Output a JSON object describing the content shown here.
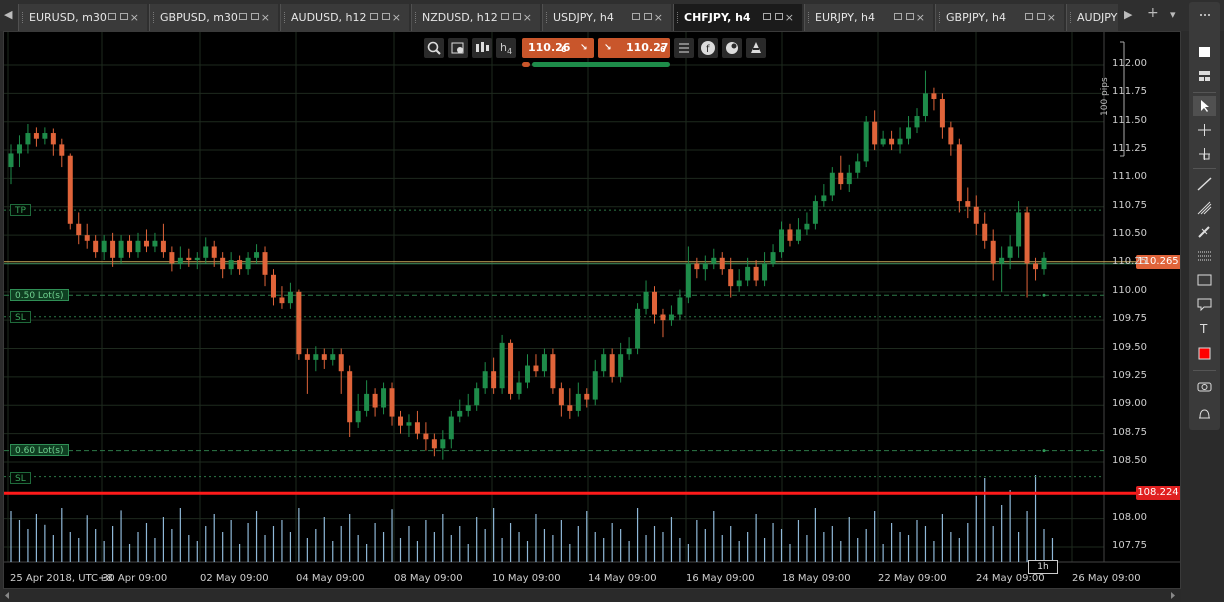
{
  "tabs": [
    {
      "label": "EURUSD, m30",
      "active": false
    },
    {
      "label": "GBPUSD, m30",
      "active": false
    },
    {
      "label": "AUDUSD, h12",
      "active": false
    },
    {
      "label": "NZDUSD, h12",
      "active": false
    },
    {
      "label": "USDJPY, h4",
      "active": false
    },
    {
      "label": "CHFJPY, h4",
      "active": true
    },
    {
      "label": "EURJPY, h4",
      "active": false
    },
    {
      "label": "GBPJPY, h4",
      "active": false
    },
    {
      "label": "AUDJPY",
      "active": false
    }
  ],
  "tabbar": {
    "prev": "◀",
    "next": "▶",
    "add": "+",
    "menu": "▾"
  },
  "chart_toolbar": {
    "timeframe_prefix": "h",
    "timeframe_sub": "4",
    "sell_price": "110.26",
    "sell_suffix": "6",
    "buy_price": "110.27",
    "buy_suffix": "6",
    "sell_arrow": "↘",
    "buy_arrow": "↘"
  },
  "levels": {
    "tp": "TP",
    "lot1": "0.50 Lot(s)",
    "sl1": "SL",
    "lot2": "0.60 Lot(s)",
    "sl2": "SL"
  },
  "price_tags": {
    "bid": "110.265",
    "line": "108.224"
  },
  "pips_label": "100 pips",
  "timeframe_marker": "1h",
  "colors": {
    "bull": "#1e8c4a",
    "bear": "#e0643a",
    "bid_tag": "#e0643a",
    "line_tag": "#e02020",
    "volume": "#8fb8d8"
  },
  "chart_data": {
    "type": "candlestick",
    "symbol": "CHFJPY",
    "timeframe": "h4",
    "ylim": [
      107.57,
      112.2
    ],
    "y_ticks": [
      "112.00",
      "111.75",
      "111.50",
      "111.25",
      "111.00",
      "110.75",
      "110.50",
      "110.25",
      "110.00",
      "109.75",
      "109.50",
      "109.25",
      "109.00",
      "108.75",
      "108.50",
      "108.00",
      "107.75"
    ],
    "x_ticks": [
      "25 Apr 2018, UTC+8",
      "30 Apr 09:00",
      "02 May 09:00",
      "04 May 09:00",
      "08 May 09:00",
      "10 May 09:00",
      "14 May 09:00",
      "16 May 09:00",
      "18 May 09:00",
      "22 May 09:00",
      "24 May 09:00",
      "26 May 09:00"
    ],
    "horizontal_lines": {
      "bid": 110.265,
      "tp": 110.72,
      "entry1": 109.97,
      "sl1": 109.78,
      "entry2": 108.6,
      "sl2": 108.37,
      "red_line": 108.224
    },
    "candles": [
      [
        111.1,
        111.22,
        111.3,
        110.95
      ],
      [
        111.22,
        111.3,
        111.38,
        111.1
      ],
      [
        111.3,
        111.4,
        111.48,
        111.22
      ],
      [
        111.4,
        111.35,
        111.45,
        111.28
      ],
      [
        111.35,
        111.4,
        111.45,
        111.3
      ],
      [
        111.4,
        111.3,
        111.44,
        111.2
      ],
      [
        111.3,
        111.2,
        111.35,
        111.1
      ],
      [
        111.2,
        110.6,
        111.22,
        110.55
      ],
      [
        110.6,
        110.5,
        110.7,
        110.42
      ],
      [
        110.5,
        110.45,
        110.6,
        110.38
      ],
      [
        110.45,
        110.35,
        110.5,
        110.3
      ],
      [
        110.35,
        110.45,
        110.5,
        110.28
      ],
      [
        110.45,
        110.3,
        110.52,
        110.22
      ],
      [
        110.3,
        110.45,
        110.5,
        110.25
      ],
      [
        110.45,
        110.35,
        110.5,
        110.3
      ],
      [
        110.35,
        110.45,
        110.52,
        110.3
      ],
      [
        110.45,
        110.4,
        110.55,
        110.35
      ],
      [
        110.4,
        110.45,
        110.52,
        110.35
      ],
      [
        110.45,
        110.35,
        110.6,
        110.3
      ],
      [
        110.35,
        110.25,
        110.4,
        110.18
      ],
      [
        110.25,
        110.3,
        110.4,
        110.2
      ],
      [
        110.3,
        110.28,
        110.38,
        110.22
      ],
      [
        110.28,
        110.3,
        110.35,
        110.2
      ],
      [
        110.3,
        110.4,
        110.48,
        110.25
      ],
      [
        110.4,
        110.3,
        110.45,
        110.22
      ],
      [
        110.3,
        110.2,
        110.35,
        110.12
      ],
      [
        110.2,
        110.28,
        110.35,
        110.15
      ],
      [
        110.28,
        110.2,
        110.32,
        110.15
      ],
      [
        110.2,
        110.3,
        110.35,
        110.15
      ],
      [
        110.3,
        110.35,
        110.42,
        110.25
      ],
      [
        110.35,
        110.15,
        110.4,
        110.05
      ],
      [
        110.15,
        109.95,
        110.2,
        109.88
      ],
      [
        109.95,
        109.9,
        110.05,
        109.85
      ],
      [
        109.9,
        110.0,
        110.08,
        109.85
      ],
      [
        110.0,
        109.45,
        110.02,
        109.4
      ],
      [
        109.45,
        109.4,
        109.5,
        109.1
      ],
      [
        109.4,
        109.45,
        109.52,
        109.3
      ],
      [
        109.45,
        109.4,
        109.5,
        109.32
      ],
      [
        109.4,
        109.45,
        109.5,
        109.35
      ],
      [
        109.45,
        109.3,
        109.5,
        109.1
      ],
      [
        109.3,
        108.85,
        109.35,
        108.72
      ],
      [
        108.85,
        108.95,
        109.1,
        108.8
      ],
      [
        108.95,
        109.1,
        109.22,
        108.9
      ],
      [
        109.1,
        108.98,
        109.15,
        108.9
      ],
      [
        108.98,
        109.15,
        109.2,
        108.92
      ],
      [
        109.15,
        108.9,
        109.2,
        108.82
      ],
      [
        108.9,
        108.82,
        108.95,
        108.75
      ],
      [
        108.82,
        108.85,
        108.92,
        108.72
      ],
      [
        108.85,
        108.75,
        108.95,
        108.7
      ],
      [
        108.75,
        108.7,
        108.85,
        108.6
      ],
      [
        108.7,
        108.62,
        108.75,
        108.55
      ],
      [
        108.62,
        108.7,
        108.78,
        108.52
      ],
      [
        108.7,
        108.9,
        108.95,
        108.62
      ],
      [
        108.9,
        108.95,
        109.05,
        108.85
      ],
      [
        108.95,
        109.0,
        109.1,
        108.9
      ],
      [
        109.0,
        109.15,
        109.2,
        108.95
      ],
      [
        109.15,
        109.3,
        109.38,
        109.1
      ],
      [
        109.3,
        109.15,
        109.42,
        109.1
      ],
      [
        109.15,
        109.55,
        109.62,
        109.1
      ],
      [
        109.55,
        109.1,
        109.58,
        109.05
      ],
      [
        109.1,
        109.2,
        109.3,
        109.05
      ],
      [
        109.2,
        109.35,
        109.45,
        109.15
      ],
      [
        109.35,
        109.3,
        109.45,
        109.25
      ],
      [
        109.3,
        109.45,
        109.5,
        109.25
      ],
      [
        109.45,
        109.15,
        109.5,
        109.1
      ],
      [
        109.15,
        109.0,
        109.2,
        108.9
      ],
      [
        109.0,
        108.95,
        109.15,
        108.88
      ],
      [
        108.95,
        109.1,
        109.2,
        108.9
      ],
      [
        109.1,
        109.05,
        109.15,
        108.98
      ],
      [
        109.05,
        109.3,
        109.4,
        109.0
      ],
      [
        109.3,
        109.45,
        109.5,
        109.25
      ],
      [
        109.45,
        109.25,
        109.5,
        109.2
      ],
      [
        109.25,
        109.45,
        109.55,
        109.2
      ],
      [
        109.45,
        109.5,
        109.6,
        109.4
      ],
      [
        109.5,
        109.85,
        109.9,
        109.45
      ],
      [
        109.85,
        110.0,
        110.1,
        109.8
      ],
      [
        110.0,
        109.8,
        110.05,
        109.72
      ],
      [
        109.8,
        109.75,
        109.85,
        109.6
      ],
      [
        109.75,
        109.8,
        109.88,
        109.7
      ],
      [
        109.8,
        109.95,
        110.02,
        109.75
      ],
      [
        109.95,
        110.25,
        110.4,
        109.9
      ],
      [
        110.25,
        110.2,
        110.3,
        110.12
      ],
      [
        110.2,
        110.25,
        110.32,
        110.1
      ],
      [
        110.25,
        110.3,
        110.38,
        110.2
      ],
      [
        110.3,
        110.2,
        110.35,
        110.15
      ],
      [
        110.2,
        110.05,
        110.3,
        109.95
      ],
      [
        110.05,
        110.1,
        110.2,
        110.0
      ],
      [
        110.1,
        110.22,
        110.3,
        110.05
      ],
      [
        110.22,
        110.1,
        110.28,
        110.05
      ],
      [
        110.1,
        110.25,
        110.35,
        110.05
      ],
      [
        110.25,
        110.35,
        110.42,
        110.22
      ],
      [
        110.35,
        110.55,
        110.62,
        110.3
      ],
      [
        110.55,
        110.45,
        110.6,
        110.4
      ],
      [
        110.45,
        110.55,
        110.65,
        110.42
      ],
      [
        110.55,
        110.6,
        110.7,
        110.5
      ],
      [
        110.6,
        110.8,
        110.85,
        110.55
      ],
      [
        110.8,
        110.85,
        110.95,
        110.75
      ],
      [
        110.85,
        111.05,
        111.1,
        110.8
      ],
      [
        111.05,
        110.95,
        111.2,
        110.9
      ],
      [
        110.95,
        111.05,
        111.12,
        110.88
      ],
      [
        111.05,
        111.15,
        111.22,
        111.0
      ],
      [
        111.15,
        111.5,
        111.55,
        111.1
      ],
      [
        111.5,
        111.3,
        111.6,
        111.25
      ],
      [
        111.3,
        111.35,
        111.42,
        111.28
      ],
      [
        111.35,
        111.3,
        111.42,
        111.25
      ],
      [
        111.3,
        111.35,
        111.45,
        111.22
      ],
      [
        111.35,
        111.45,
        111.55,
        111.3
      ],
      [
        111.45,
        111.55,
        111.62,
        111.4
      ],
      [
        111.55,
        111.75,
        111.95,
        111.5
      ],
      [
        111.75,
        111.7,
        111.8,
        111.6
      ],
      [
        111.7,
        111.45,
        111.75,
        111.35
      ],
      [
        111.45,
        111.3,
        111.5,
        111.2
      ],
      [
        111.3,
        110.8,
        111.35,
        110.7
      ],
      [
        110.8,
        110.75,
        110.92,
        110.65
      ],
      [
        110.75,
        110.6,
        110.85,
        110.5
      ],
      [
        110.6,
        110.45,
        110.7,
        110.38
      ],
      [
        110.45,
        110.25,
        110.55,
        110.1
      ],
      [
        110.25,
        110.3,
        110.4,
        110.0
      ],
      [
        110.3,
        110.4,
        110.5,
        110.2
      ],
      [
        110.4,
        110.7,
        110.8,
        110.3
      ],
      [
        110.7,
        110.25,
        110.75,
        109.95
      ],
      [
        110.25,
        110.2,
        110.3,
        110.1
      ],
      [
        110.2,
        110.3,
        110.35,
        110.15
      ]
    ],
    "volume_heights": [
      0.85,
      0.7,
      0.55,
      0.8,
      0.62,
      0.45,
      0.9,
      0.5,
      0.4,
      0.78,
      0.55,
      0.35,
      0.6,
      0.86,
      0.3,
      0.5,
      0.65,
      0.4,
      0.75,
      0.55,
      0.9,
      0.45,
      0.35,
      0.6,
      0.8,
      0.5,
      0.7,
      0.3,
      0.65,
      0.85,
      0.45,
      0.6,
      0.7,
      0.5,
      0.9,
      0.4,
      0.55,
      0.75,
      0.35,
      0.6,
      0.8,
      0.45,
      0.3,
      0.65,
      0.5,
      0.88,
      0.4,
      0.6,
      0.35,
      0.7,
      0.5,
      0.8,
      0.45,
      0.6,
      0.3,
      0.75,
      0.55,
      0.9,
      0.4,
      0.65,
      0.5,
      0.35,
      0.8,
      0.55,
      0.45,
      0.7,
      0.3,
      0.6,
      0.85,
      0.5,
      0.4,
      0.65,
      0.55,
      0.35,
      0.9,
      0.45,
      0.6,
      0.5,
      0.75,
      0.4,
      0.3,
      0.7,
      0.55,
      0.85,
      0.45,
      0.6,
      0.35,
      0.5,
      0.8,
      0.4,
      0.65,
      0.55,
      0.3,
      0.7,
      0.45,
      0.9,
      0.5,
      0.6,
      0.35,
      0.75,
      0.4,
      0.55,
      0.85,
      0.3,
      0.65,
      0.5,
      0.45,
      0.7,
      0.6,
      0.35,
      0.8,
      0.5,
      0.4,
      0.65,
      1.1,
      1.4,
      0.6,
      0.95,
      1.2,
      0.5,
      0.85,
      1.45,
      0.55,
      0.4
    ]
  },
  "right_toolbar": [
    "square",
    "layout",
    "cursor",
    "crosshair",
    "zoom-cross",
    "line",
    "fib",
    "pencil",
    "grid",
    "rect",
    "bubble",
    "arrow",
    "text",
    "color",
    "camera",
    "alert"
  ]
}
